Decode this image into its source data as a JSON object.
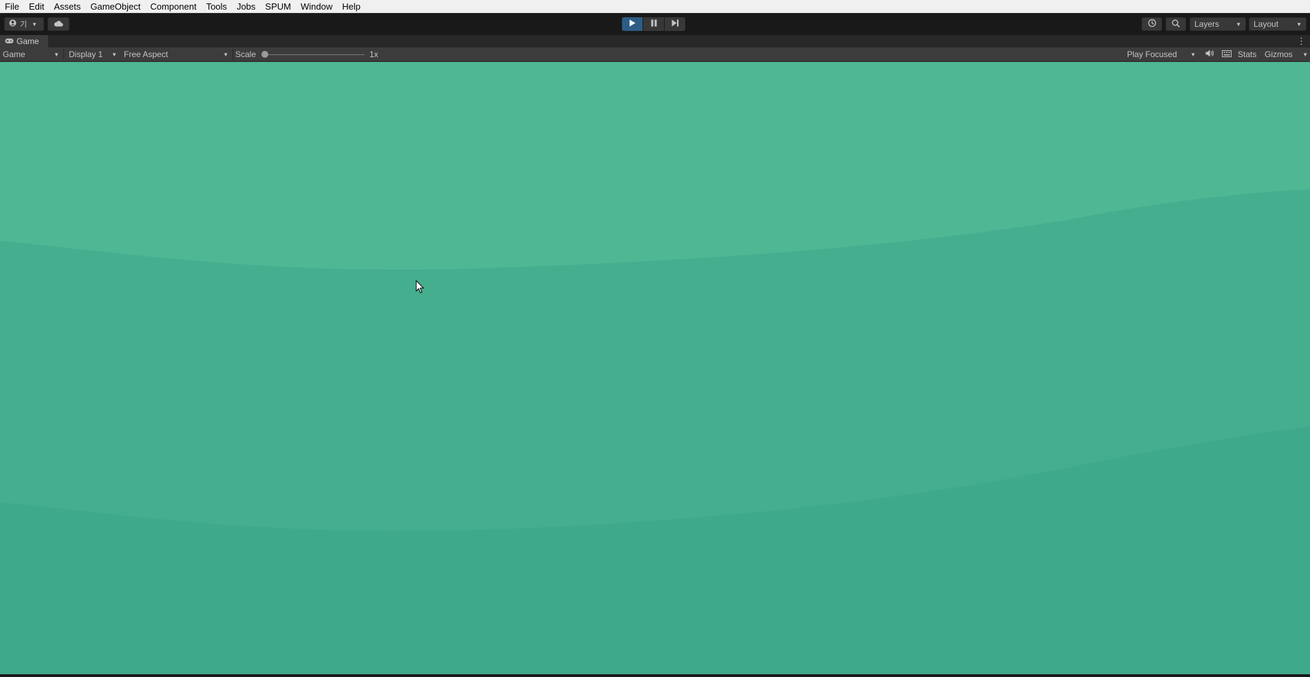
{
  "menubar": {
    "items": [
      "File",
      "Edit",
      "Assets",
      "GameObject",
      "Component",
      "Tools",
      "Jobs",
      "SPUM",
      "Window",
      "Help"
    ]
  },
  "toolbar": {
    "account_label": "기",
    "account_icon": "account-icon",
    "cloud_icon": "cloud-icon",
    "play_icon": "play-icon",
    "pause_icon": "pause-icon",
    "step_icon": "step-icon",
    "history_icon": "history-icon",
    "search_icon": "search-icon",
    "layers_label": "Layers",
    "layout_label": "Layout",
    "accent_color": "#2d5c87"
  },
  "tab": {
    "title": "Game",
    "icon": "gamepad-icon"
  },
  "game_view": {
    "view_mode": "Game",
    "display": "Display 1",
    "aspect": "Free Aspect",
    "scale_label": "Scale",
    "scale_value": "1x",
    "play_mode": "Play Focused",
    "stats_label": "Stats",
    "gizmos_label": "Gizmos"
  },
  "viewport": {
    "colors": {
      "sky": "#4fb794",
      "band_mid": "#45ae8f",
      "band_low": "#3fa98b"
    }
  }
}
